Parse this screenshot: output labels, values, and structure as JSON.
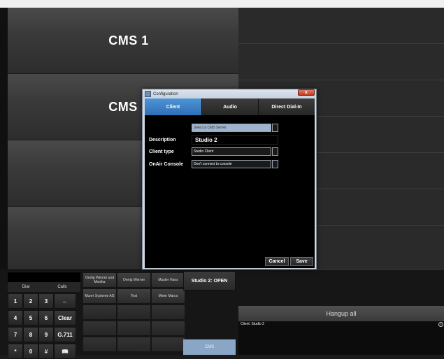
{
  "cms_tiles": [
    "CMS 1",
    "CMS 2"
  ],
  "dialpad": {
    "display_value": "",
    "tabs": [
      "Dial",
      "Calls"
    ],
    "keys": [
      "1",
      "2",
      "3",
      "←",
      "4",
      "5",
      "6",
      "Clear",
      "7",
      "8",
      "9",
      "G.711",
      "*",
      "0",
      "#",
      "📖"
    ]
  },
  "favorites": [
    "Oertig Werner und Monika",
    "Oertig Werner",
    "Muster Hans",
    "Murer Systeme AG",
    "Test",
    "Meier Marco"
  ],
  "status_button": "Studio 2: OPEN",
  "cms_button": "CMS",
  "hangup_all": "Hangup all",
  "client_panel": {
    "label": "Client: Studio 2",
    "close_icon": "close-circle-icon"
  },
  "dialog": {
    "title": "Configuration",
    "close_label": "x",
    "tabs": [
      "Client",
      "Audio",
      "Direct Dial-In"
    ],
    "server_select": {
      "value": "Select a CMS Server"
    },
    "fields": [
      {
        "label": "Description",
        "value": "Studio 2"
      },
      {
        "label": "Client type",
        "value": "Studio Client"
      },
      {
        "label": "OnAir Console",
        "value": "Don't connect to console"
      }
    ],
    "cancel_label": "Cancel",
    "save_label": "Save"
  },
  "colors": {
    "active_tab": "#3a7fc4",
    "cms_button": "#8aa6c6",
    "dialog_frame": "#cfd8e3"
  }
}
